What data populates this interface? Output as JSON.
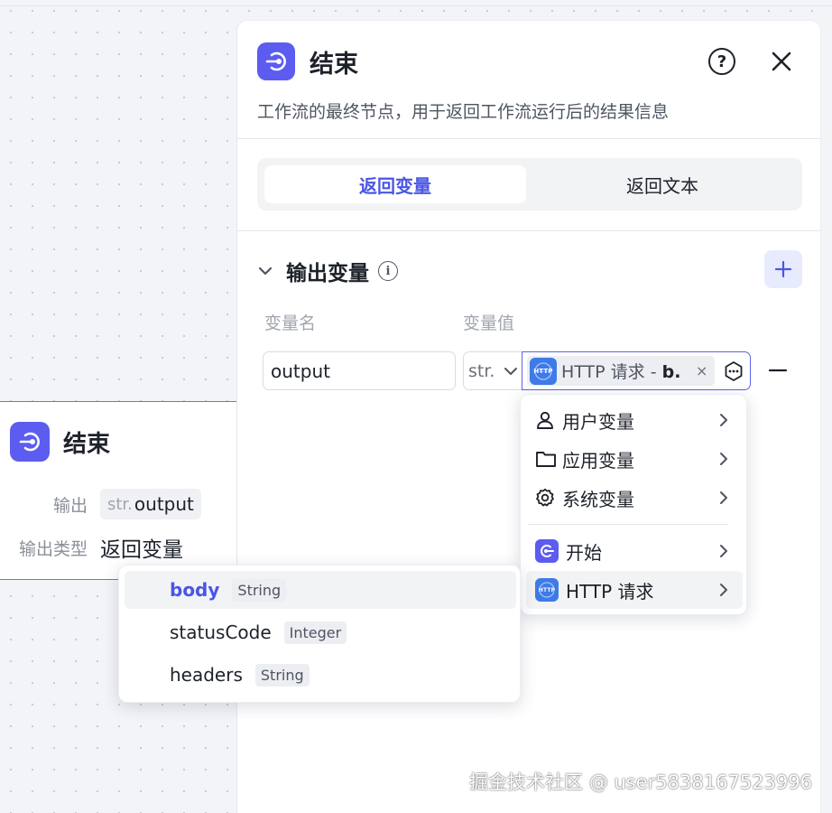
{
  "canvas_node": {
    "title": "结束",
    "output_label": "输出",
    "output_prefix": "str.",
    "output_name": "output",
    "output_type_label": "输出类型",
    "output_type_value": "返回变量"
  },
  "panel": {
    "title": "结束",
    "description": "工作流的最终节点，用于返回工作流运行后的结果信息",
    "tabs": [
      {
        "label": "返回变量",
        "active": true
      },
      {
        "label": "返回文本",
        "active": false
      }
    ],
    "section_title": "输出变量",
    "col_name": "变量名",
    "col_value": "变量值",
    "variable": {
      "name": "output",
      "type": "str.",
      "value_chip_prefix": "HTTP 请求 - ",
      "value_chip_field": "b.",
      "value_chip_remove": "×"
    }
  },
  "menu": {
    "items": [
      {
        "label": "用户变量",
        "icon": "user-icon"
      },
      {
        "label": "应用变量",
        "icon": "folder-icon"
      },
      {
        "label": "系统变量",
        "icon": "gear-icon"
      },
      {
        "label": "开始",
        "icon": "start-node-icon"
      },
      {
        "label": "HTTP 请求",
        "icon": "http-node-icon",
        "highlighted": true
      }
    ]
  },
  "submenu": {
    "items": [
      {
        "name": "body",
        "type": "String",
        "selected": true
      },
      {
        "name": "statusCode",
        "type": "Integer",
        "selected": false
      },
      {
        "name": "headers",
        "type": "String",
        "selected": false
      }
    ]
  },
  "icon_text": {
    "http": "HTTP",
    "help": "?",
    "info": "i"
  },
  "watermark": "掘金技术社区 @ user5838167523996",
  "colors": {
    "accent": "#4a55e5",
    "node_icon": "#5c5cf0",
    "http_icon": "#3e7be8"
  }
}
